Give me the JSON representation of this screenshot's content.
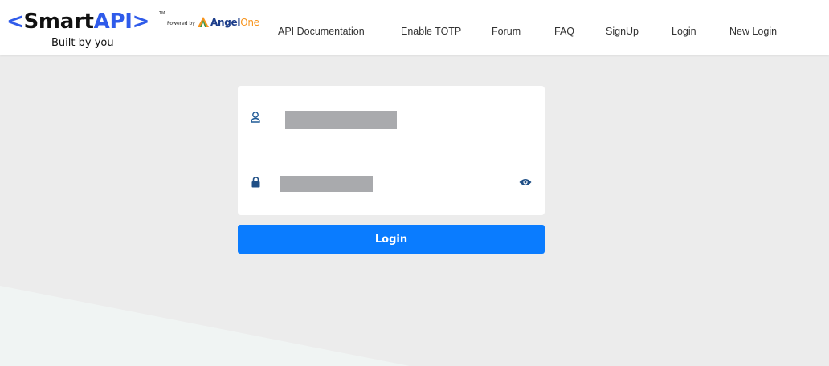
{
  "brand": {
    "logo_bracket_open": "<",
    "logo_smart": "Smart",
    "logo_api": "API",
    "logo_bracket_close": ">",
    "logo_tm": "TM",
    "tagline": "Built by you",
    "powered_by": "Powered by",
    "partner_name_main": "Angel",
    "partner_name_suffix": "One",
    "primary_color": "#2f5bea",
    "partner_accent": "#f7941d"
  },
  "nav": {
    "items": [
      {
        "label": "API Documentation"
      },
      {
        "label": "Enable TOTP"
      },
      {
        "label": "Forum"
      },
      {
        "label": "FAQ"
      },
      {
        "label": "SignUp"
      },
      {
        "label": "Login"
      },
      {
        "label": "New Login"
      }
    ]
  },
  "login_form": {
    "username_icon": "user-icon",
    "password_icon": "lock-icon",
    "toggle_icon": "eye-icon",
    "submit_label": "Login",
    "button_color": "#0a7cff"
  }
}
